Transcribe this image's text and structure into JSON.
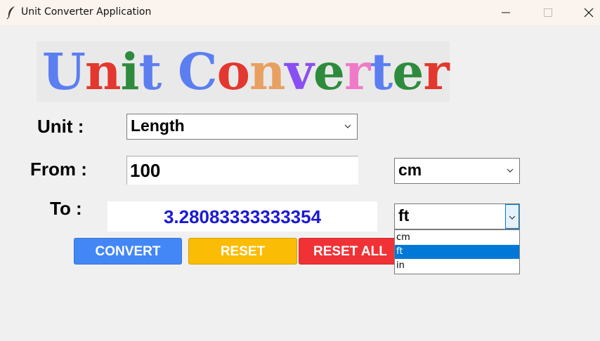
{
  "window": {
    "title": "Unit Converter Application",
    "icon": "feather-icon",
    "controls": [
      "minimize-icon",
      "maximize-icon",
      "close-icon"
    ]
  },
  "banner": {
    "letters": [
      {
        "ch": "U",
        "color": "#5b7ff0"
      },
      {
        "ch": "n",
        "color": "#e2382f"
      },
      {
        "ch": "i",
        "color": "#2e8b3e"
      },
      {
        "ch": "t",
        "color": "#5b7ff0"
      },
      {
        "ch": " ",
        "color": "#000000"
      },
      {
        "ch": "C",
        "color": "#5b7ff0"
      },
      {
        "ch": "o",
        "color": "#e2382f"
      },
      {
        "ch": "n",
        "color": "#e8a060"
      },
      {
        "ch": "v",
        "color": "#8a4ff0"
      },
      {
        "ch": "e",
        "color": "#2e8b3e"
      },
      {
        "ch": "r",
        "color": "#f07ac8"
      },
      {
        "ch": "t",
        "color": "#5b7ff0"
      },
      {
        "ch": "e",
        "color": "#2e8b3e"
      },
      {
        "ch": "r",
        "color": "#e2382f"
      }
    ]
  },
  "labels": {
    "unit": "Unit :",
    "from": "From :",
    "to": "To :"
  },
  "unit_select": {
    "value": "Length"
  },
  "from": {
    "value": "100",
    "unit": "cm"
  },
  "to": {
    "value": "3.28083333333354",
    "unit": "ft"
  },
  "buttons": {
    "convert": "CONVERT",
    "reset": "RESET",
    "reset_all": "RESET ALL"
  },
  "to_dropdown": {
    "options": [
      "cm",
      "ft",
      "in"
    ],
    "selected": "ft"
  },
  "colors": {
    "convert": "#4287f5",
    "reset": "#fbbc05",
    "reset_all": "#f03236",
    "result_text": "#1a1ad6",
    "selection": "#0078d7"
  }
}
